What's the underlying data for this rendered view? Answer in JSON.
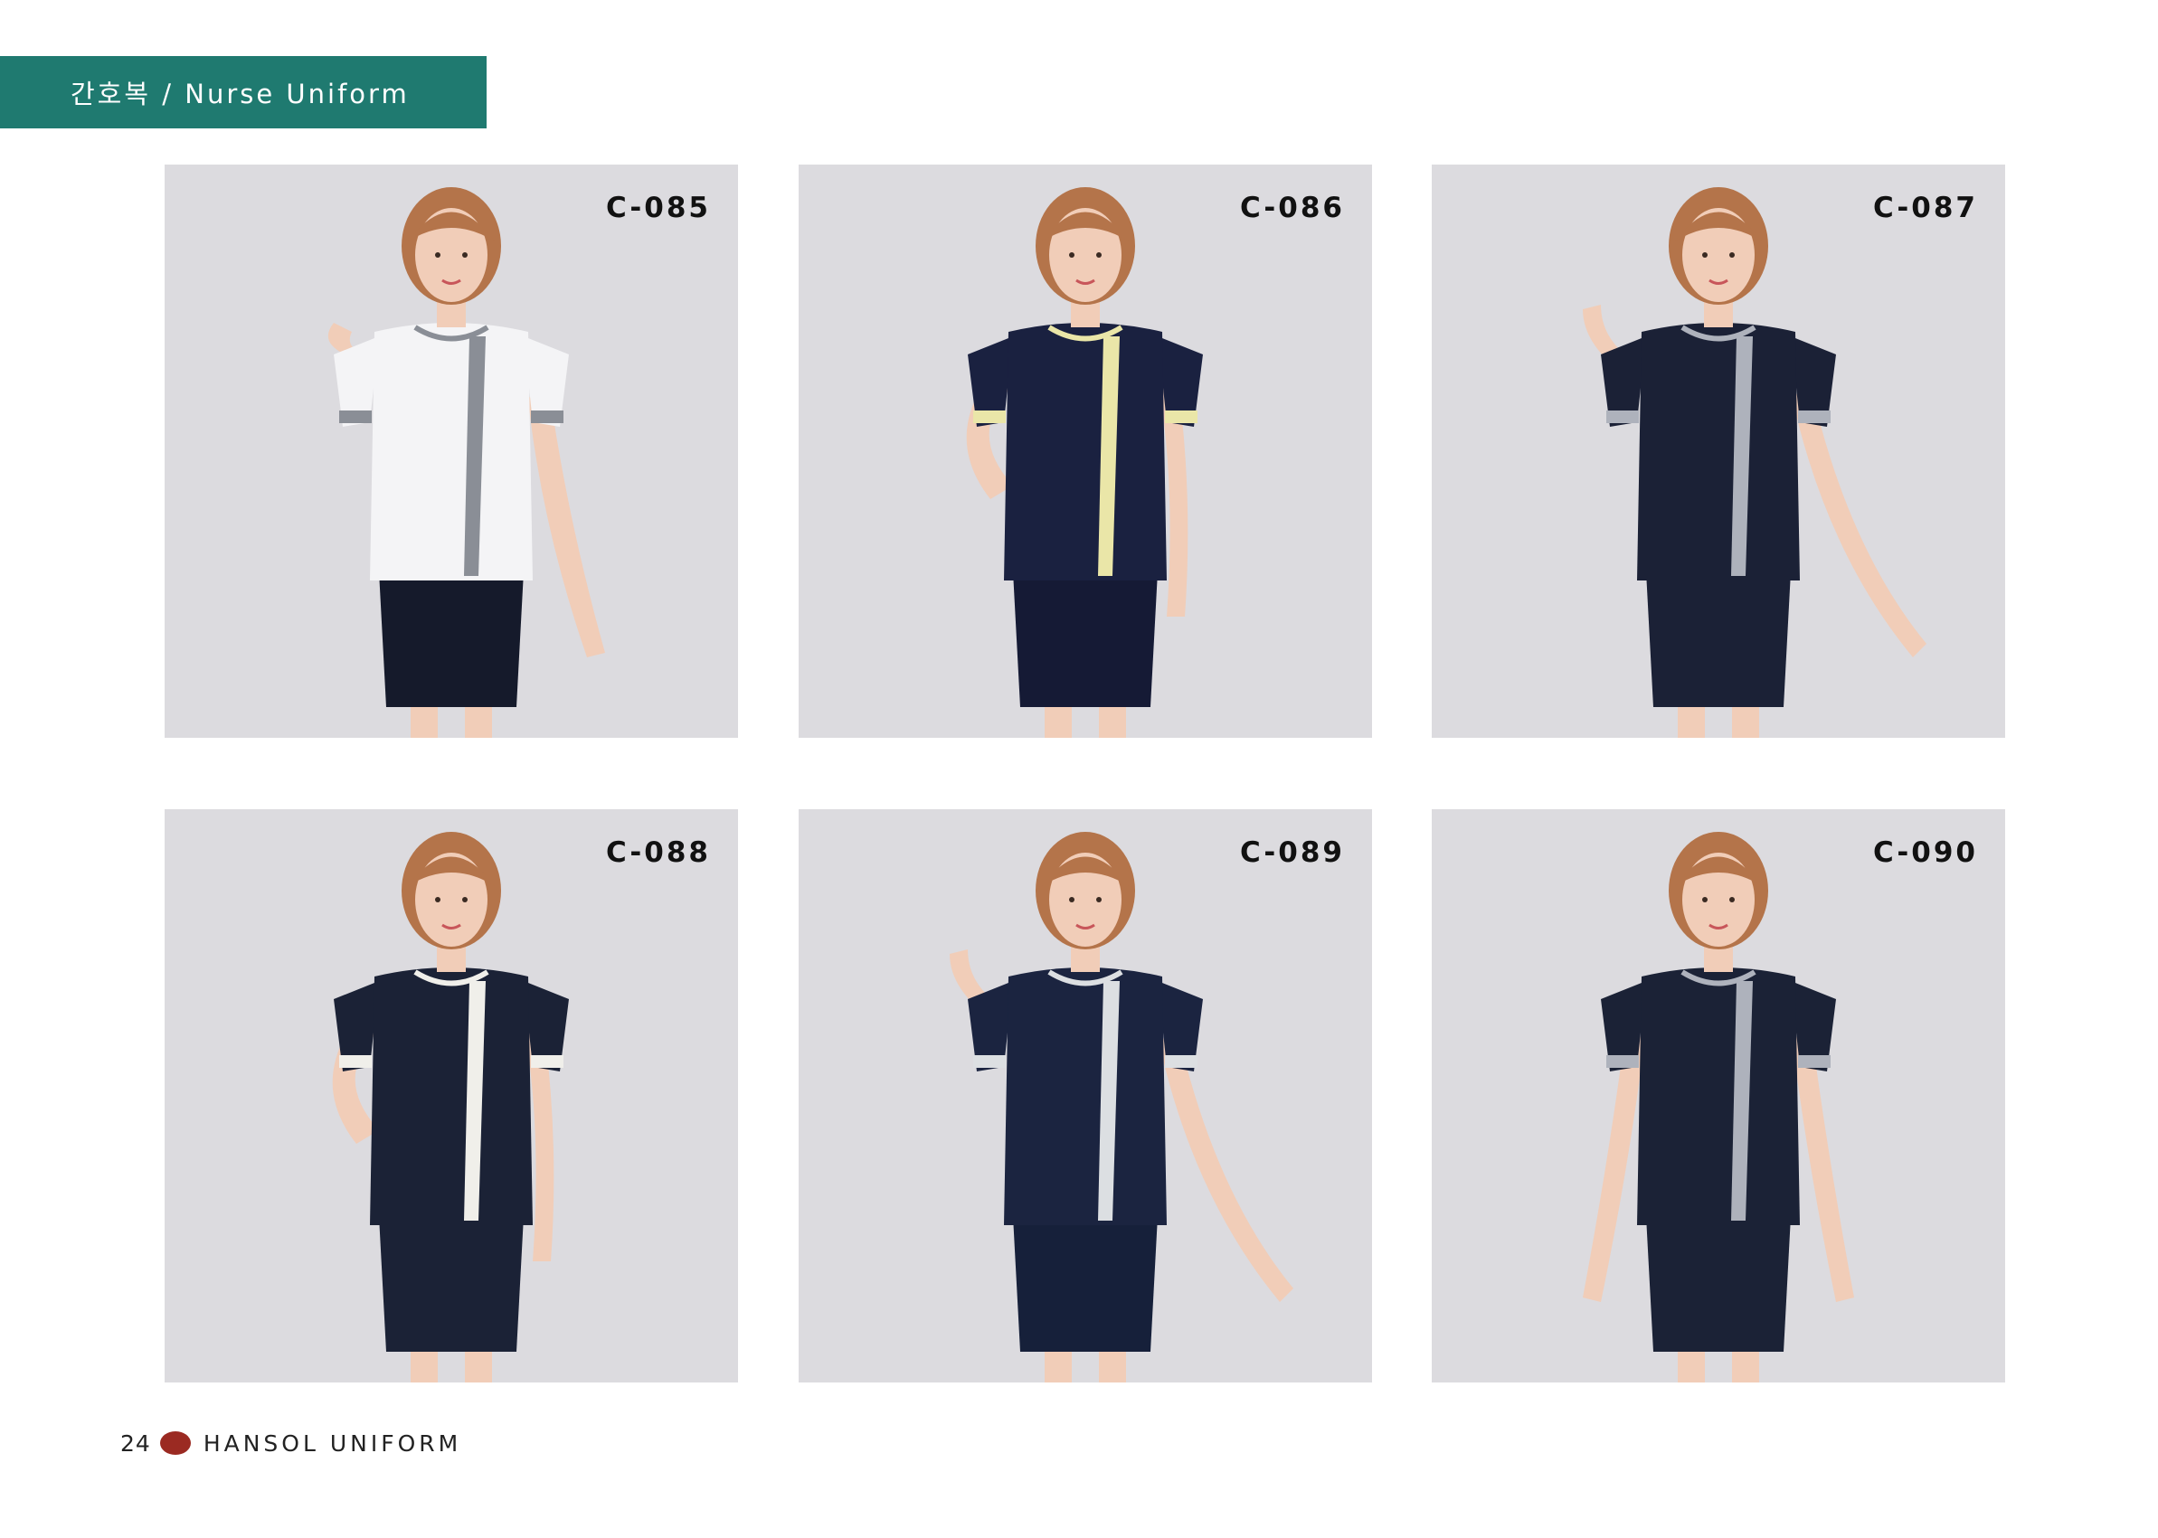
{
  "header": {
    "title": "간호복 / Nurse Uniform",
    "color": "#1f7a70"
  },
  "products": [
    {
      "code": "C-085",
      "top_color": "#f4f4f6",
      "accent_color": "#8a8e96",
      "skirt_color": "#151a2b",
      "pose": "hand-at-shoulder"
    },
    {
      "code": "C-086",
      "top_color": "#1a2140",
      "accent_color": "#eae6a8",
      "skirt_color": "#151a35",
      "pose": "hand-on-hip"
    },
    {
      "code": "C-087",
      "top_color": "#1b2136",
      "accent_color": "#aeb2bc",
      "skirt_color": "#1b2136",
      "pose": "hand-raised"
    },
    {
      "code": "C-088",
      "top_color": "#1b2236",
      "accent_color": "#f0efea",
      "skirt_color": "#1b2236",
      "pose": "hand-on-hip"
    },
    {
      "code": "C-089",
      "top_color": "#1b2440",
      "accent_color": "#dcdfe2",
      "skirt_color": "#16203a",
      "pose": "hand-raised"
    },
    {
      "code": "C-090",
      "top_color": "#1b2236",
      "accent_color": "#aeb2bc",
      "skirt_color": "#1b2236",
      "pose": "arms-down"
    }
  ],
  "footer": {
    "page_number": "24",
    "brand": "HANSOL UNIFORM",
    "brand_dot_color": "#9b2a22"
  }
}
